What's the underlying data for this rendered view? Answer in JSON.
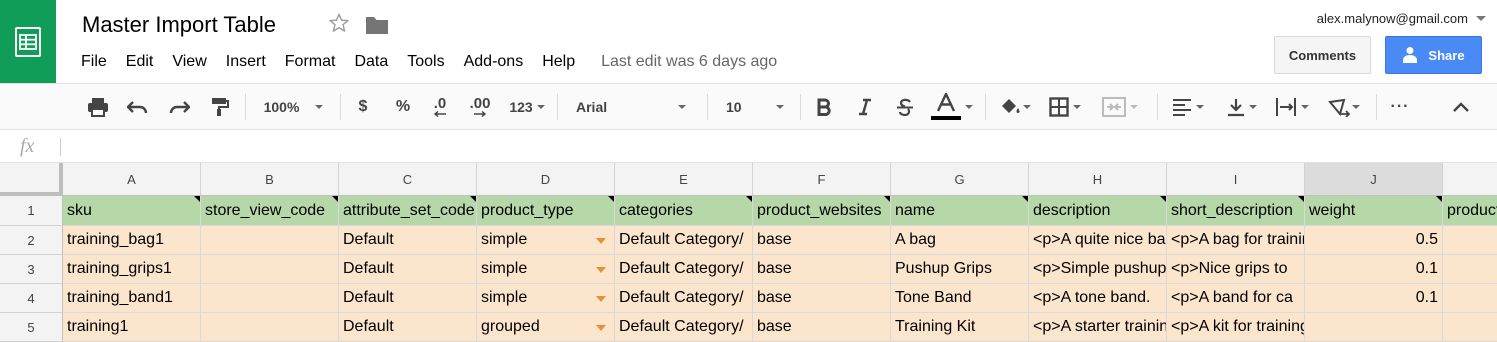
{
  "doc": {
    "title": "Master Import Table"
  },
  "account": {
    "email": "alex.malynow@gmail.com"
  },
  "buttons": {
    "comments": "Comments",
    "share": "Share"
  },
  "menu": {
    "items": [
      "File",
      "Edit",
      "View",
      "Insert",
      "Format",
      "Data",
      "Tools",
      "Add-ons",
      "Help"
    ],
    "last_edit": "Last edit was 6 days ago"
  },
  "toolbar": {
    "zoom": "100%",
    "currency": "$",
    "percent": "%",
    "decrease_decimals": ".0",
    "increase_decimals": ".00",
    "more_formats": "123",
    "font": "Arial",
    "font_size": "10",
    "more": "···"
  },
  "formula_bar": {
    "label": "fx",
    "value": ""
  },
  "grid": {
    "columns": [
      "A",
      "B",
      "C",
      "D",
      "E",
      "F",
      "G",
      "H",
      "I",
      "J"
    ],
    "selected_column": "J",
    "row_numbers": [
      "1",
      "2",
      "3",
      "4",
      "5"
    ],
    "header_row": [
      "sku",
      "store_view_code",
      "attribute_set_code",
      "product_type",
      "categories",
      "product_websites",
      "name",
      "description",
      "short_description",
      "weight",
      "product_online"
    ],
    "rows": [
      [
        "training_bag1",
        "",
        "Default",
        "simple",
        "Default Category/",
        "base",
        "A bag",
        "<p>A quite nice bag",
        "<p>A bag for training",
        "0.5",
        ""
      ],
      [
        "training_grips1",
        "",
        "Default",
        "simple",
        "Default Category/",
        "base",
        "Pushup Grips",
        "<p>Simple pushup",
        "<p>Nice grips to",
        "0.1",
        ""
      ],
      [
        "training_band1",
        "",
        "Default",
        "simple",
        "Default Category/",
        "base",
        "Tone Band",
        "<p>A tone band.",
        "<p>A band for ca",
        "0.1",
        ""
      ],
      [
        "training1",
        "",
        "Default",
        "grouped",
        "Default Category/",
        "base",
        "Training Kit",
        "<p>A starter training",
        "<p>A kit for training.</p>",
        "",
        ""
      ]
    ]
  },
  "colors": {
    "header_fill": "#b6d7a8",
    "data_fill": "#fce5cd",
    "brand": "#0F9D58",
    "share": "#4a8af4",
    "dropdown_arrow": "#e69138"
  }
}
